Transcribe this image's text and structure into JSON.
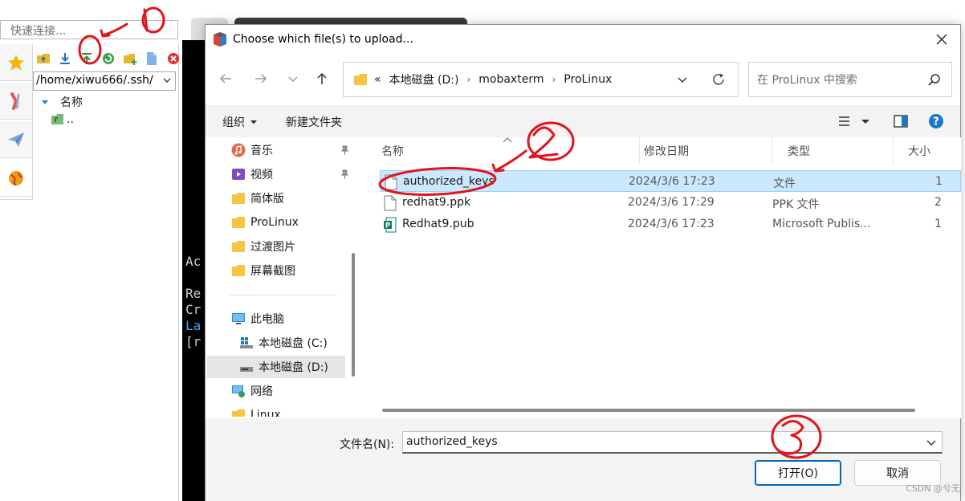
{
  "background_app": {
    "quick_connect_placeholder": "快速连接...",
    "sftp_path": "/home/xiwu666/.ssh/",
    "tree_header": "名称",
    "tree_parent": "..",
    "terminal_lines": [
      "Ac",
      "Re",
      "Cr",
      "La",
      "[r"
    ]
  },
  "dialog": {
    "title": "Choose which file(s) to upload...",
    "breadcrumb": [
      "«",
      "本地磁盘 (D:)",
      "mobaxterm",
      "ProLinux"
    ],
    "search_placeholder": "在 ProLinux 中搜索",
    "commands": {
      "organize": "组织",
      "new_folder": "新建文件夹"
    },
    "nav_pane": {
      "quick_access": [
        {
          "label": "音乐",
          "icon": "music-icon",
          "pinned": true
        },
        {
          "label": "视频",
          "icon": "video-icon",
          "pinned": true
        },
        {
          "label": "简体版",
          "icon": "folder-icon",
          "pinned": false
        },
        {
          "label": "ProLinux",
          "icon": "folder-icon",
          "pinned": false
        },
        {
          "label": "过渡图片",
          "icon": "folder-icon",
          "pinned": false
        },
        {
          "label": "屏幕截图",
          "icon": "folder-icon",
          "pinned": false
        }
      ],
      "this_pc": "此电脑",
      "drive_c": "本地磁盘 (C:)",
      "drive_d": "本地磁盘 (D:)",
      "network": "网络",
      "linux": "Linux"
    },
    "columns": {
      "name": "名称",
      "modified": "修改日期",
      "type": "类型",
      "size": "大小"
    },
    "files": [
      {
        "name": "authorized_keys",
        "modified": "2024/3/6 17:23",
        "type": "文件",
        "size": "1",
        "selected": true
      },
      {
        "name": "redhat9.ppk",
        "modified": "2024/3/6 17:29",
        "type": "PPK 文件",
        "size": "2",
        "selected": false
      },
      {
        "name": "Redhat9.pub",
        "modified": "2024/3/6 17:23",
        "type": "Microsoft Publis...",
        "size": "1",
        "selected": false
      }
    ],
    "filename_label": "文件名(N):",
    "filename_value": "authorized_keys",
    "open_button": "打开(O)",
    "cancel_button": "取消"
  },
  "watermark": "CSDN @兮无",
  "colors": {
    "annotation": "#e0141b",
    "selection": "#cce8ff",
    "accent": "#0067c0"
  }
}
